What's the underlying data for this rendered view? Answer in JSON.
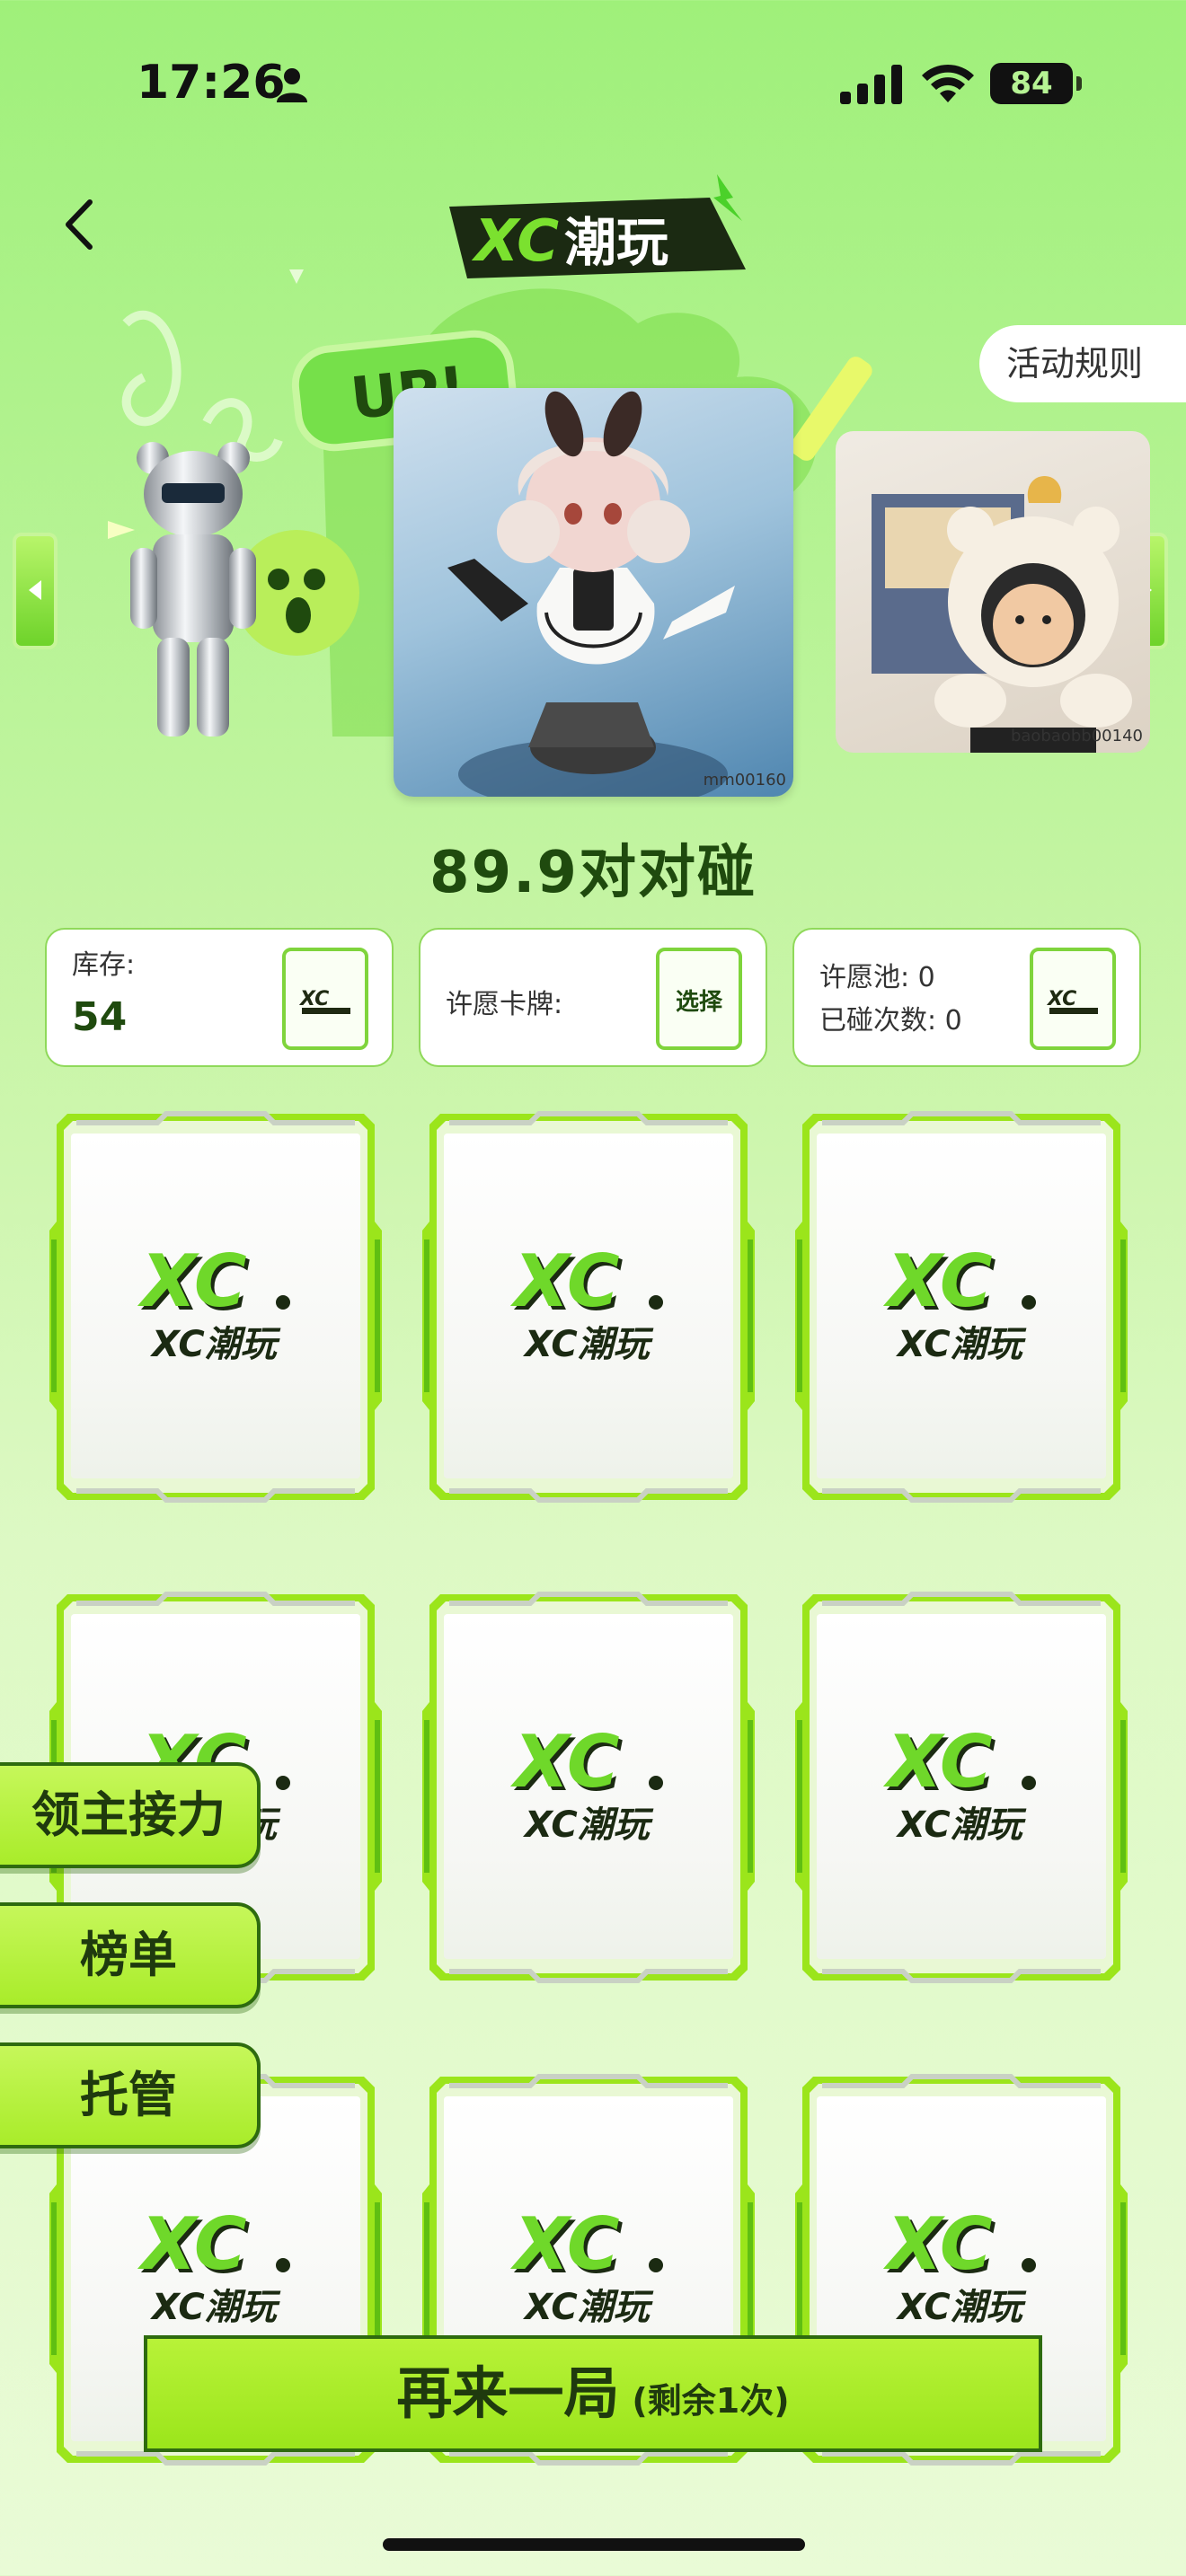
{
  "status_bar": {
    "time": "17:26",
    "battery": "84"
  },
  "header": {
    "logo_text": "XC潮玩",
    "rules_label": "活动规则"
  },
  "banner": {
    "up_text": "UP!",
    "main_product_code": "mm00160",
    "right_product_code": "baobaobb00140"
  },
  "game_title": "89.9对对碰",
  "info": {
    "stock_label": "库存:",
    "stock_value": "54",
    "wish_card_label": "许愿卡牌:",
    "choose_label": "选择",
    "wish_pool_label": "许愿池: 0",
    "hit_count_label": "已碰次数: 0"
  },
  "card_logo": {
    "big": "XC.",
    "small": "XC潮玩"
  },
  "side_buttons": {
    "relay": "领主接力",
    "ranking": "榜单",
    "auto": "托管"
  },
  "bottom": {
    "again_label": "再来一局",
    "remaining": "(剩余1次)"
  },
  "colors": {
    "accent": "#9be51b",
    "dark_green": "#1f4a0e",
    "border_green": "#2e6b0f"
  }
}
